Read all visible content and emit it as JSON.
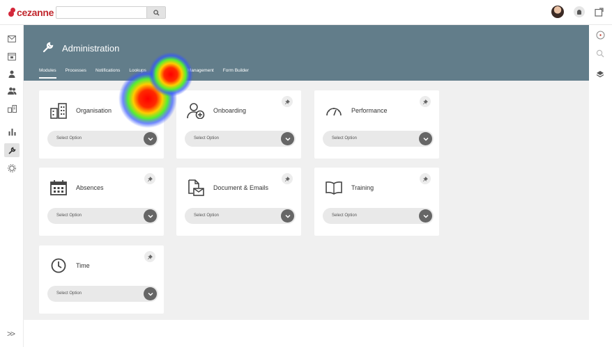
{
  "brand": {
    "name": "cezanne",
    "color": "#c1272d"
  },
  "search": {
    "placeholder": "",
    "icon": "search-icon"
  },
  "header": {
    "title": "Administration"
  },
  "tabs": [
    {
      "label": "Modules",
      "active": true
    },
    {
      "label": "Processes"
    },
    {
      "label": "Notifications"
    },
    {
      "label": "Lookups"
    },
    {
      "label": "Fields"
    },
    {
      "label": "Data Management"
    },
    {
      "label": "Form Builder"
    }
  ],
  "cards": [
    {
      "title": "Organisation",
      "icon": "building-icon",
      "select": "Select Option",
      "pinned": false
    },
    {
      "title": "Onboarding",
      "icon": "user-add-icon",
      "select": "Select Option",
      "pinned": true
    },
    {
      "title": "Performance",
      "icon": "gauge-icon",
      "select": "Select Option",
      "pinned": true
    },
    {
      "title": "Absences",
      "icon": "calendar-icon",
      "select": "Select Option",
      "pinned": true
    },
    {
      "title": "Document & Emails",
      "icon": "document-email-icon",
      "select": "Select Option",
      "pinned": true
    },
    {
      "title": "Training",
      "icon": "book-icon",
      "select": "Select Option",
      "pinned": true
    },
    {
      "title": "Time",
      "icon": "clock-icon",
      "select": "Select Option",
      "pinned": true
    }
  ],
  "sidebar": {
    "icons": [
      "mail-icon",
      "calendar-icon",
      "person-icon",
      "people-icon",
      "org-chart-icon",
      "bar-chart-icon",
      "wrench-icon",
      "gear-icon"
    ],
    "expand": ">>"
  },
  "rightbar": {
    "icons": [
      "clock-compass-icon",
      "search-icon",
      "layers-icon"
    ]
  },
  "colors": {
    "banner": "#627d8a",
    "content_bg": "#f0f0f0",
    "select_btn": "#666666"
  }
}
